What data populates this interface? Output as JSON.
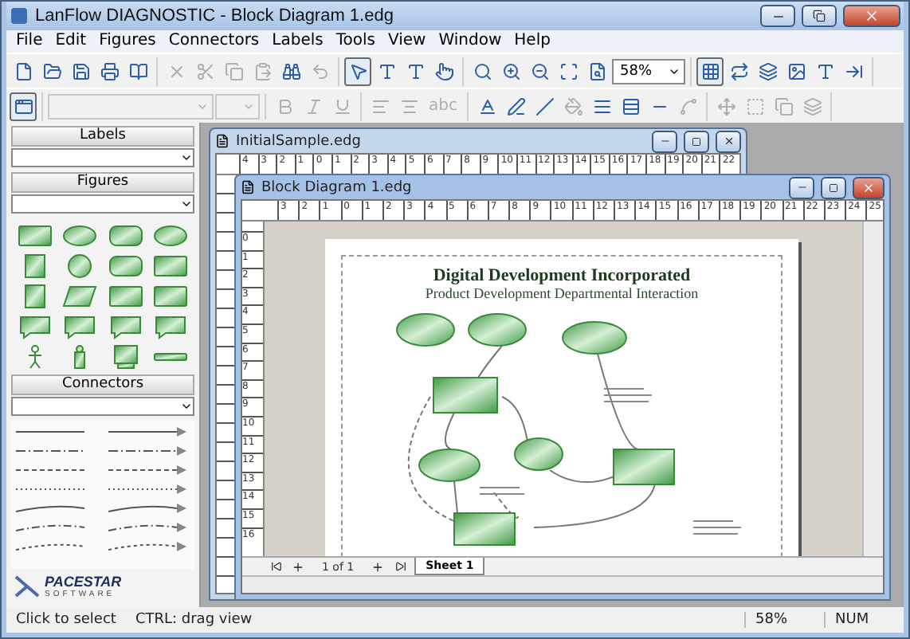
{
  "window": {
    "title": "LanFlow DIAGNOSTIC - Block Diagram 1.edg"
  },
  "menu": [
    "File",
    "Edit",
    "Figures",
    "Connectors",
    "Labels",
    "Tools",
    "View",
    "Window",
    "Help"
  ],
  "toolbar_main": {
    "groups": [
      {
        "items": [
          {
            "kind": "new",
            "disabled": false,
            "selected": false
          },
          {
            "kind": "open",
            "disabled": false,
            "selected": false
          },
          {
            "kind": "save",
            "disabled": false,
            "selected": false
          },
          {
            "kind": "print",
            "disabled": false,
            "selected": false
          },
          {
            "kind": "help",
            "disabled": false,
            "selected": false
          }
        ]
      },
      {
        "items": [
          {
            "kind": "delete",
            "disabled": true,
            "selected": false
          },
          {
            "kind": "cut",
            "disabled": true,
            "selected": false
          },
          {
            "kind": "copy",
            "disabled": true,
            "selected": false
          },
          {
            "kind": "paste",
            "disabled": true,
            "selected": false
          },
          {
            "kind": "find",
            "disabled": false,
            "selected": false
          },
          {
            "kind": "undo",
            "disabled": true,
            "selected": false
          }
        ]
      },
      {
        "items": [
          {
            "kind": "select",
            "disabled": false,
            "selected": true
          },
          {
            "kind": "text-tool",
            "disabled": false,
            "selected": false
          },
          {
            "kind": "text",
            "disabled": false,
            "selected": false
          },
          {
            "kind": "connect",
            "disabled": false,
            "selected": false
          }
        ]
      },
      {
        "items": [
          {
            "kind": "search",
            "disabled": false,
            "selected": false
          },
          {
            "kind": "zoom-in",
            "disabled": false,
            "selected": false
          },
          {
            "kind": "zoom-out",
            "disabled": false,
            "selected": false
          },
          {
            "kind": "zoom-fit",
            "disabled": false,
            "selected": false
          },
          {
            "kind": "zoom-page",
            "disabled": false,
            "selected": false
          },
          {
            "kind": "combo",
            "value": "58%",
            "disabled": false,
            "selected": false
          }
        ]
      },
      {
        "items": [
          {
            "kind": "grid",
            "disabled": false,
            "selected": true
          },
          {
            "kind": "swap",
            "disabled": false,
            "selected": false
          },
          {
            "kind": "layers",
            "disabled": false,
            "selected": false
          },
          {
            "kind": "image",
            "disabled": false,
            "selected": false
          },
          {
            "kind": "text",
            "disabled": false,
            "selected": false
          },
          {
            "kind": "export",
            "disabled": false,
            "selected": false
          }
        ]
      }
    ]
  },
  "toolbar_format": {
    "groups": [
      {
        "items": [
          {
            "kind": "window",
            "disabled": false,
            "selected": true
          }
        ]
      },
      {
        "items": [
          {
            "kind": "font-field",
            "disabled": true,
            "selected": false
          },
          {
            "kind": "size-field",
            "disabled": true,
            "selected": false
          }
        ]
      },
      {
        "items": [
          {
            "kind": "bold",
            "disabled": true,
            "selected": false
          },
          {
            "kind": "italic",
            "disabled": true,
            "selected": false
          },
          {
            "kind": "underline",
            "disabled": true,
            "selected": false
          }
        ]
      },
      {
        "items": [
          {
            "kind": "align-left",
            "disabled": true,
            "selected": false
          },
          {
            "kind": "align-center",
            "disabled": true,
            "selected": false
          },
          {
            "kind": "label",
            "text": "abc",
            "disabled": true,
            "selected": false
          }
        ]
      },
      {
        "items": [
          {
            "kind": "text-color",
            "disabled": false,
            "selected": false
          },
          {
            "kind": "line-width",
            "disabled": false,
            "selected": false
          },
          {
            "kind": "line-color",
            "disabled": false,
            "selected": false
          },
          {
            "kind": "fill",
            "disabled": true,
            "selected": false
          },
          {
            "kind": "line-style",
            "disabled": false,
            "selected": false
          },
          {
            "kind": "line-thick",
            "disabled": false,
            "selected": false
          },
          {
            "kind": "line-end",
            "disabled": false,
            "selected": false
          },
          {
            "kind": "curve",
            "disabled": true,
            "selected": false
          }
        ]
      },
      {
        "items": [
          {
            "kind": "move",
            "disabled": true,
            "selected": false
          },
          {
            "kind": "group",
            "disabled": true,
            "selected": false
          },
          {
            "kind": "copy",
            "disabled": true,
            "selected": false
          },
          {
            "kind": "layers",
            "disabled": true,
            "selected": false
          }
        ]
      }
    ]
  },
  "sidebar": {
    "sections": [
      {
        "title": "Labels"
      },
      {
        "title": "Figures"
      },
      {
        "title": "Connectors"
      }
    ],
    "logo": {
      "name": "PACESTAR",
      "tagline": "SOFTWARE"
    }
  },
  "back_window": {
    "title": "InitialSample.edg",
    "ruler": [
      "4",
      "3",
      "2",
      "1",
      "0",
      "1",
      "2",
      "3",
      "4",
      "5",
      "6",
      "7",
      "8",
      "9",
      "10",
      "11",
      "12",
      "13",
      "14",
      "15",
      "16",
      "17",
      "18",
      "19",
      "20",
      "21",
      "22"
    ]
  },
  "front_window": {
    "title": "Block Diagram 1.edg",
    "ruler": [
      "3",
      "2",
      "1",
      "0",
      "1",
      "2",
      "3",
      "4",
      "5",
      "6",
      "7",
      "8",
      "9",
      "10",
      "11",
      "12",
      "13",
      "14",
      "15",
      "16",
      "17",
      "18",
      "19",
      "20",
      "21",
      "22",
      "23",
      "24",
      "25"
    ],
    "vruler": [
      "0",
      "1",
      "2",
      "3",
      "4",
      "5",
      "6",
      "7",
      "8",
      "9",
      "10",
      "11",
      "12",
      "13",
      "14",
      "15",
      "16"
    ],
    "page": {
      "title": "Digital Development Incorporated",
      "subtitle": "Product Development Departmental Interaction"
    },
    "pager": "1 of 1",
    "sheets": [
      {
        "label": "Sheet 1",
        "selected": true
      }
    ]
  },
  "status_bar": [
    "Click to select",
    "CTRL: drag view",
    "58%",
    "NUM"
  ]
}
